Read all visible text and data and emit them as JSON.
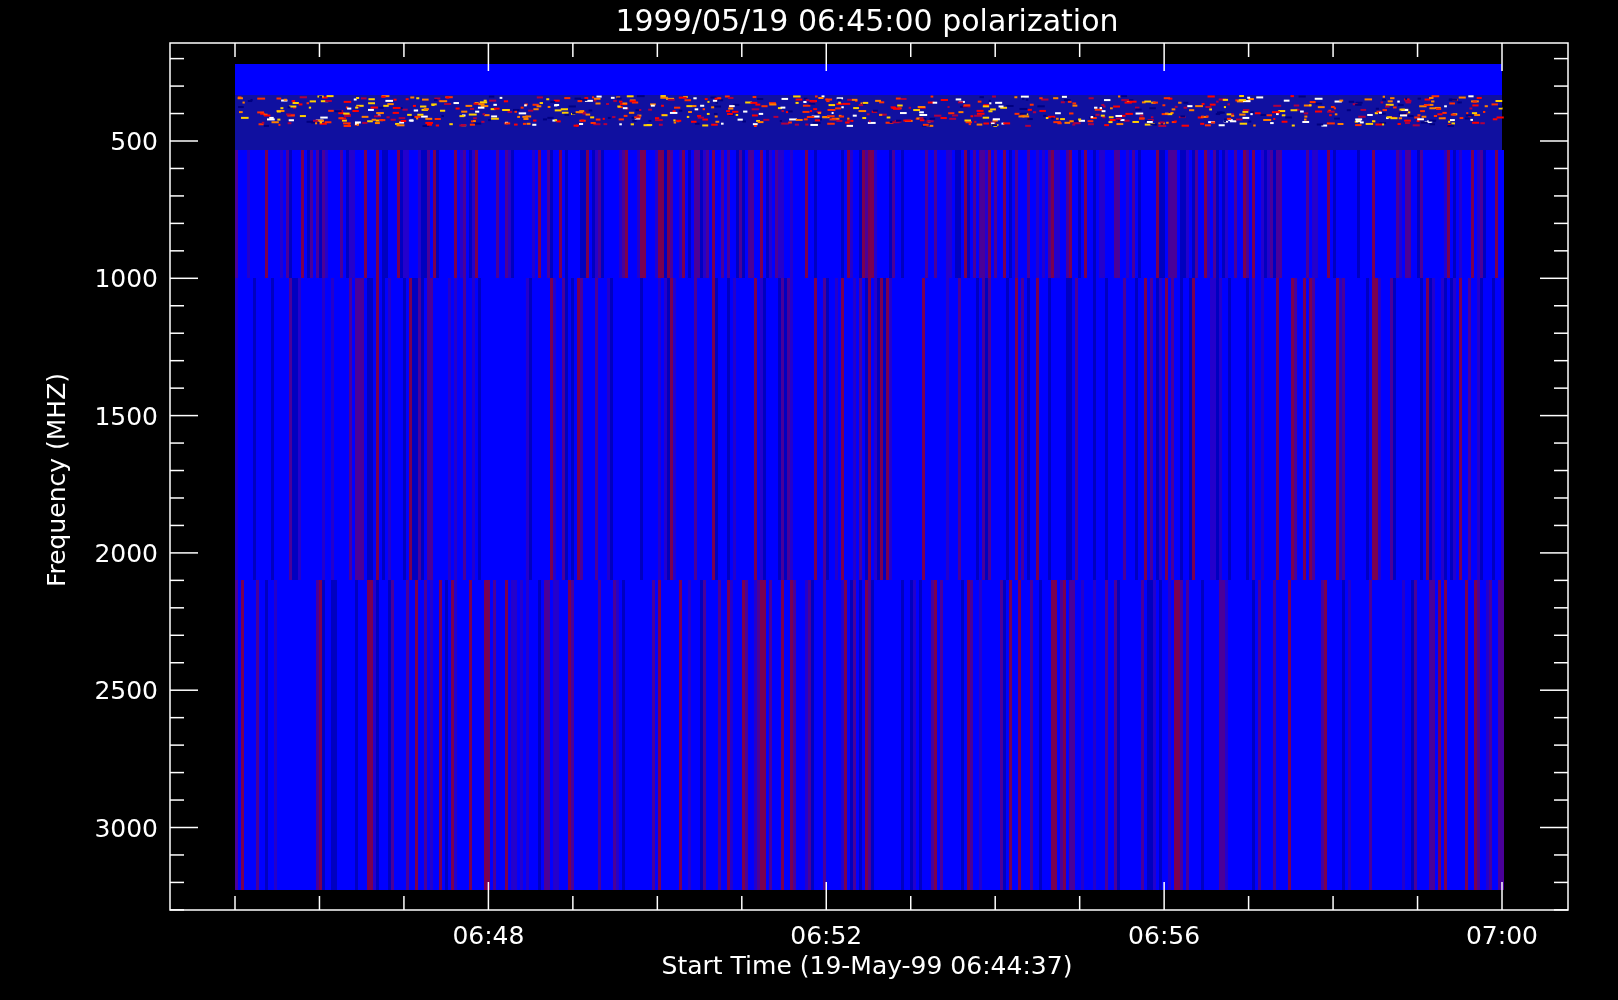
{
  "title": "1999/05/19 06:45:00 polarization",
  "plot": {
    "ylabel": "Frequency (MHZ)",
    "xlabel": "Start Time (19-May-99 06:44:37)",
    "yticks": [
      "500",
      "1000",
      "1500",
      "2000",
      "2500",
      "3000"
    ],
    "xticks": [
      "06:48",
      "06:52",
      "06:56",
      "07:00"
    ]
  }
}
